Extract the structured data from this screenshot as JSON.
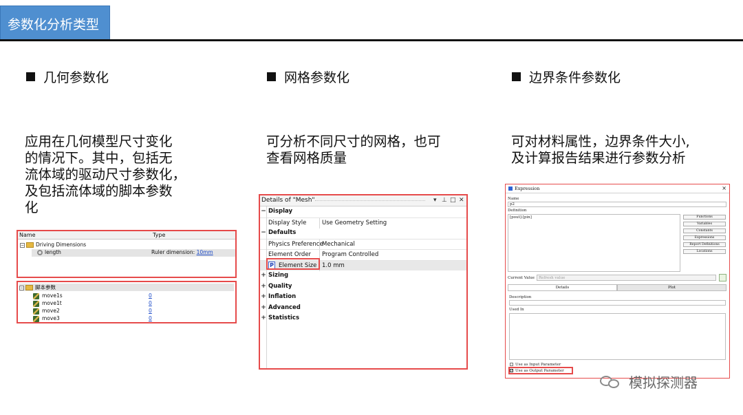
{
  "page_title": "参数化分析类型",
  "columns": [
    {
      "heading": "几何参数化",
      "description_lines": [
        "应用在几何模型尺寸变化",
        "的情况下。其中，包括无",
        "流体域的驱动尺寸参数化，",
        "及包括流体域的脚本参数",
        "化"
      ]
    },
    {
      "heading": "网格参数化",
      "description_lines": [
        "可分析不同尺寸的网格，也可",
        "查看网格质量"
      ]
    },
    {
      "heading": "边界条件参数化",
      "description_lines": [
        "可对材料属性，边界条件大小,",
        "及计算报告结果进行参数分析"
      ]
    }
  ],
  "driving_panel": {
    "col_name": "Name",
    "col_type": "Type",
    "group": "Driving Dimensions",
    "item_name": "length",
    "item_type": "Ruler dimension: ",
    "item_value": "10mm"
  },
  "script_panel": {
    "group": "脚本参数",
    "items": [
      {
        "name": "move1s",
        "value": "0"
      },
      {
        "name": "move1t",
        "value": "0"
      },
      {
        "name": "move2",
        "value": "0"
      },
      {
        "name": "move3",
        "value": "0"
      }
    ]
  },
  "mesh_details": {
    "title": "Details of \"Mesh\"",
    "title_buttons": [
      "▾",
      "⊥",
      "□",
      "✕"
    ],
    "rows": [
      {
        "type": "section",
        "expand": "−",
        "label": "Display"
      },
      {
        "type": "prop",
        "label": "Display Style",
        "value": "Use Geometry Setting"
      },
      {
        "type": "section",
        "expand": "−",
        "label": "Defaults"
      },
      {
        "type": "prop",
        "label": "Physics Preference",
        "value": "Mechanical"
      },
      {
        "type": "prop",
        "label": "Element Order",
        "value": "Program Controlled"
      },
      {
        "type": "prop",
        "label": "Element Size",
        "value": "1.0 mm",
        "param_badge": "P"
      },
      {
        "type": "section",
        "expand": "+",
        "label": "Sizing"
      },
      {
        "type": "section",
        "expand": "+",
        "label": "Quality"
      },
      {
        "type": "section",
        "expand": "+",
        "label": "Inflation"
      },
      {
        "type": "section",
        "expand": "+",
        "label": "Advanced"
      },
      {
        "type": "section",
        "expand": "+",
        "label": "Statistics"
      }
    ]
  },
  "expression_dialog": {
    "title": "Expression",
    "close": "×",
    "name_label": "Name",
    "name_value": "p2",
    "definition_label": "Definition",
    "definition_value": "[pout]-[pin]",
    "buttons": [
      "Functions",
      "Variables",
      "Constants",
      "Expressions",
      "Report Definitions",
      "Locations"
    ],
    "current_value_label": "Current Value",
    "current_value_placeholder": "Refresh value",
    "tabs": [
      "Details",
      "Plot"
    ],
    "description_label": "Description",
    "used_in_label": "Used In",
    "use_input": "Use as Input Parameter",
    "use_output": "Use as Output Parameter"
  },
  "watermark": "模拟探测器",
  "colors": {
    "title_blue": "#4f8fd0",
    "highlight_red": "#e64a4a",
    "link_blue": "#1a49c7"
  }
}
